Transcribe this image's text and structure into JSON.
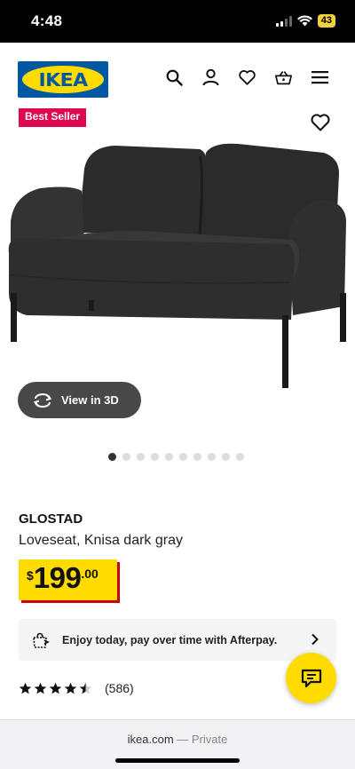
{
  "status": {
    "time": "4:48",
    "battery": "43"
  },
  "header": {
    "logo": "IKEA"
  },
  "gallery": {
    "badge": "Best Seller",
    "view3d_label": "View in 3D",
    "page_count": 10,
    "active_page": 1
  },
  "product": {
    "name": "GLOSTAD",
    "description": "Loveseat, Knisa dark gray",
    "price": {
      "currency": "$",
      "int": "199",
      "dec": ".00"
    }
  },
  "afterpay": {
    "text": "Enjoy today, pay over time with Afterpay."
  },
  "rating": {
    "stars": 4.5,
    "count": "(586)"
  },
  "browser": {
    "domain": "ikea.com",
    "mode": "— Private"
  },
  "colors": {
    "ikea_blue": "#0058a3",
    "ikea_yellow": "#ffdb00",
    "badge_red": "#e00751",
    "price_shadow": "#cc0008"
  }
}
